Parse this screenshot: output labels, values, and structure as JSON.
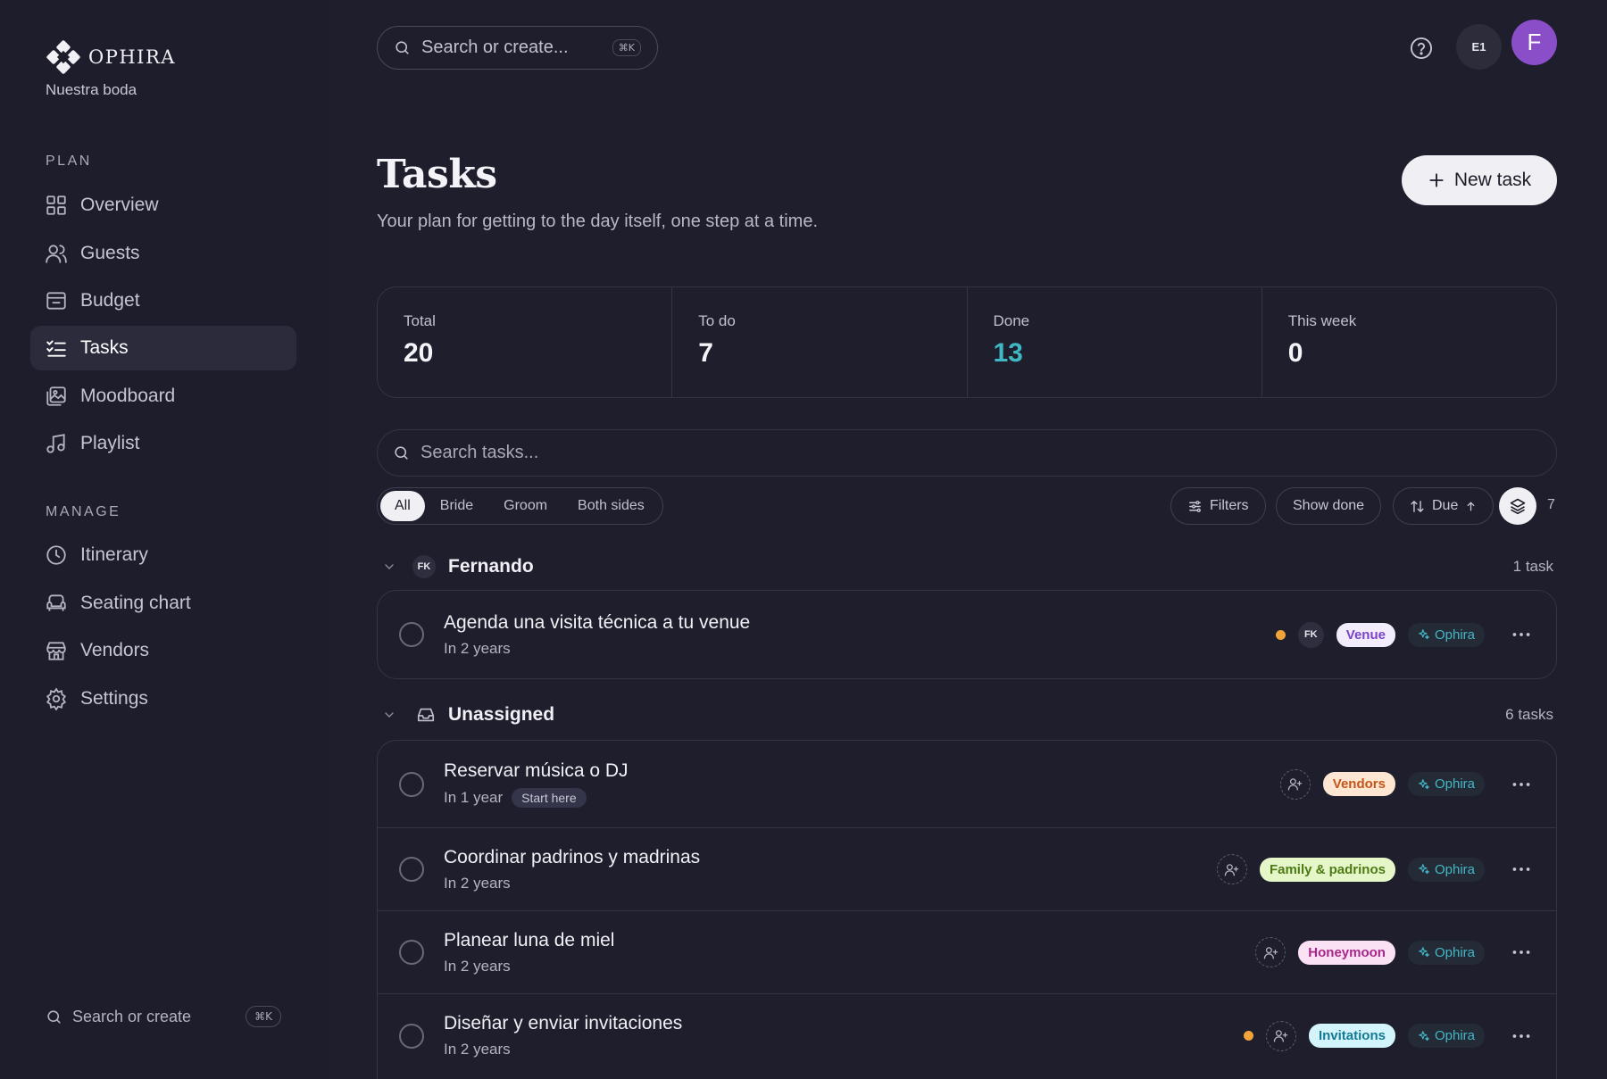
{
  "brand": {
    "name": "OPHIRA",
    "subtitle": "Nuestra boda"
  },
  "nav": {
    "plan_label": "PLAN",
    "plan_items": [
      {
        "label": "Overview",
        "icon": "grid-icon"
      },
      {
        "label": "Guests",
        "icon": "users-icon"
      },
      {
        "label": "Budget",
        "icon": "wallet-icon"
      },
      {
        "label": "Tasks",
        "icon": "checklist-icon",
        "active": true
      },
      {
        "label": "Moodboard",
        "icon": "images-icon"
      },
      {
        "label": "Playlist",
        "icon": "music-icon"
      }
    ],
    "manage_label": "MANAGE",
    "manage_items": [
      {
        "label": "Itinerary",
        "icon": "clock-icon"
      },
      {
        "label": "Seating chart",
        "icon": "armchair-icon"
      },
      {
        "label": "Vendors",
        "icon": "store-icon"
      },
      {
        "label": "Settings",
        "icon": "gear-icon"
      }
    ],
    "search_label": "Search or create",
    "search_kbd": "⌘K"
  },
  "topbar": {
    "search_placeholder": "Search or create...",
    "search_kbd": "⌘K",
    "workspace_avatar": "E1",
    "user_avatar": "F"
  },
  "header": {
    "title": "Tasks",
    "subtitle": "Your plan for getting to the day itself, one step at a time.",
    "new_task_label": "New task"
  },
  "stats": [
    {
      "label": "Total",
      "value": "20"
    },
    {
      "label": "To do",
      "value": "7"
    },
    {
      "label": "Done",
      "value": "13"
    },
    {
      "label": "This week",
      "value": "0"
    }
  ],
  "filters": {
    "search_placeholder": "Search tasks...",
    "segments": [
      "All",
      "Bride",
      "Groom",
      "Both sides"
    ],
    "active_segment": "All",
    "filters_label": "Filters",
    "show_done_label": "Show done",
    "sort_label": "Due",
    "group_count": "7"
  },
  "groups": [
    {
      "badge": "FK",
      "name": "Fernando",
      "count": "1 task",
      "tasks": [
        {
          "title": "Agenda una visita técnica a tu venue",
          "due": "In 2 years",
          "assignee": "FK",
          "tag": "Venue",
          "source": "Ophira",
          "priority": true
        }
      ]
    },
    {
      "name": "Unassigned",
      "count": "6 tasks",
      "tasks": [
        {
          "title": "Reservar música o DJ",
          "due": "In 1 year",
          "chip": "Start here",
          "tag": "Vendors",
          "source": "Ophira"
        },
        {
          "title": "Coordinar padrinos y madrinas",
          "due": "In 2 years",
          "tag": "Family & padrinos",
          "source": "Ophira"
        },
        {
          "title": "Planear luna de miel",
          "due": "In 2 years",
          "tag": "Honeymoon",
          "source": "Ophira"
        },
        {
          "title": "Diseñar y enviar invitaciones",
          "due": "In 2 years",
          "tag": "Invitations",
          "source": "Ophira",
          "priority": true
        }
      ]
    }
  ],
  "colors": {
    "background": "#1e1e2d",
    "accent": "#3fb8c4",
    "priority": "#f2a33a",
    "avatar": "#8a4ec9"
  }
}
